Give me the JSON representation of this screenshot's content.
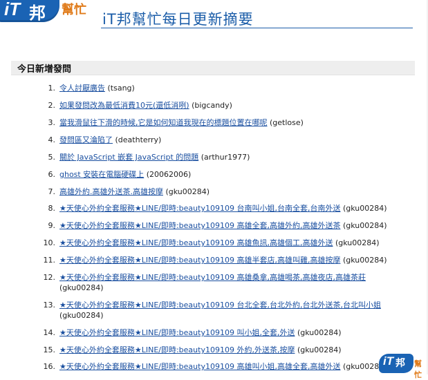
{
  "logo": {
    "it": "iT",
    "bang": "邦",
    "help": "幫忙"
  },
  "page_title": "iT邦幫忙每日更新摘要",
  "section_title": "今日新增發問",
  "items": [
    {
      "num": "1.",
      "title": "令人討厭廣告",
      "author": "(tsang)"
    },
    {
      "num": "2.",
      "title": "如果發問改為最低消費10元(還低消咧)",
      "author": "(bigcandy)"
    },
    {
      "num": "3.",
      "title": "當我滑鼠往下滑的時候,它是如何知道我現在的標題位置在哪呢",
      "author": "(getlose)"
    },
    {
      "num": "4.",
      "title": "發問區又淪陷了",
      "author": "(deathterry)"
    },
    {
      "num": "5.",
      "title": "關於 JavaScript 嵌套 JavaScript 的問題",
      "author": "(arthur1977)"
    },
    {
      "num": "6.",
      "title": "ghost 安裝在電腦硬碟上",
      "author": "(20062006)"
    },
    {
      "num": "7.",
      "title": "高雄外約.高雄外送茶.高雄按摩",
      "author": "(gku00284)"
    },
    {
      "num": "8.",
      "title": "★天使心外約全套服務★LINE/即時:beauty109109 台南叫小姐,台南全套,台南外送",
      "author": "(gku00284)"
    },
    {
      "num": "9.",
      "title": "★天使心外約全套服務★LINE/即時:beauty109109 高雄全套,高雄外約,高雄外送茶",
      "author": "(gku00284)"
    },
    {
      "num": "10.",
      "title": "★天使心外約全套服務★LINE/即時:beauty109109 高雄魚訊,高雄個工,高雄外送",
      "author": "(gku00284)"
    },
    {
      "num": "11.",
      "title": "★天使心外約全套服務★LINE/即時:beauty109109 高雄半套店,高雄叫雞,高雄按摩",
      "author": "(gku00284)"
    },
    {
      "num": "12.",
      "title": "★天使心外約全套服務★LINE/即時:beauty109109 高雄桑拿,高雄喝茶,高雄夜店,高雄茶莊",
      "author": "(gku00284)"
    },
    {
      "num": "13.",
      "title": "★天使心外約全套服務★LINE/即時:beauty109109 台北全套,台北外約,台北外送茶,台北叫小姐",
      "author": "(gku00284)"
    },
    {
      "num": "14.",
      "title": "★天使心外約全套服務★LINE/即時:beauty109109 叫小姐,全套,外送",
      "author": "(gku00284)"
    },
    {
      "num": "15.",
      "title": "★天使心外約全套服務★LINE/即時:beauty109109 外約,外送茶,按摩",
      "author": "(gku00284)"
    },
    {
      "num": "16.",
      "title": "★天使心外約全套服務★LINE/即時:beauty109109 高雄叫小姐,高雄全套,高雄外送",
      "author": "(gku00284)"
    }
  ],
  "colors": {
    "link": "#1a4fa0",
    "brand_blue": "#1a63b4",
    "brand_orange": "#e07b1a",
    "title_blue": "#1a5ca8"
  }
}
